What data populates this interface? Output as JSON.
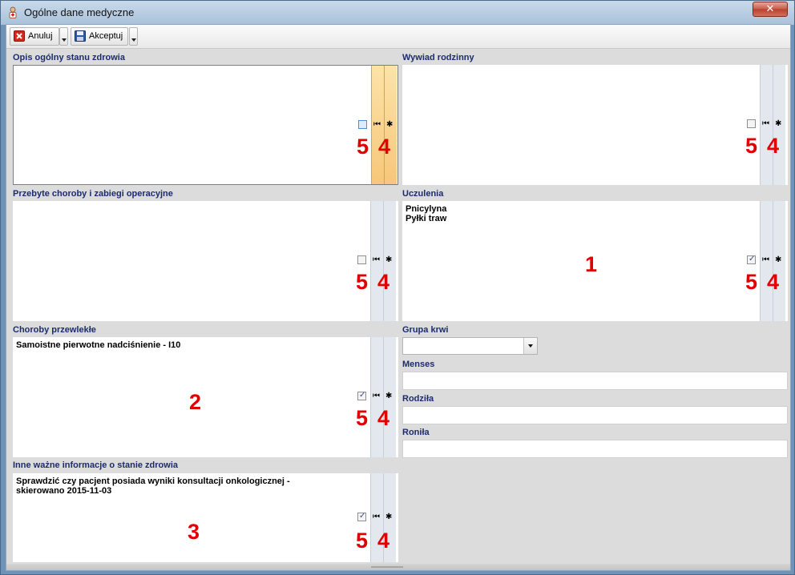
{
  "window": {
    "title": "Ogólne dane medyczne",
    "close_label": "✕"
  },
  "toolbar": {
    "cancel_label": "Anuluj",
    "accept_label": "Akceptuj"
  },
  "sections": {
    "opis": {
      "label": "Opis ogólny stanu zdrowia",
      "text": ""
    },
    "przebyte": {
      "label": "Przebyte choroby i zabiegi operacyjne",
      "text": ""
    },
    "choroby": {
      "label": "Choroby przewlekłe",
      "text": "Samoistne pierwotne nadciśnienie - I10"
    },
    "inne": {
      "label": "Inne ważne informacje o stanie zdrowia",
      "text": "Sprawdzić czy pacjent posiada wyniki konsultacji onkologicznej -\nskierowano 2015-11-03"
    },
    "wywiad": {
      "label": "Wywiad rodzinny",
      "text": ""
    },
    "uczulenia": {
      "label": "Uczulenia",
      "text": "Pnicylyna\nPyłki traw"
    }
  },
  "fields": {
    "grupa_krwi": {
      "label": "Grupa krwi",
      "value": ""
    },
    "menses": {
      "label": "Menses",
      "value": ""
    },
    "rodzila": {
      "label": "Rodziła",
      "value": ""
    },
    "ronila": {
      "label": "Roniła",
      "value": ""
    }
  },
  "controls": {
    "first_glyph": "⏮",
    "asterisk_glyph": "✱"
  },
  "markers": {
    "m1": "1",
    "m2": "2",
    "m3": "3",
    "m4": "4",
    "m5": "5"
  },
  "checkbox_states": {
    "opis": false,
    "przebyte": false,
    "choroby": true,
    "inne": true,
    "wywiad": false,
    "uczulenia": true
  }
}
